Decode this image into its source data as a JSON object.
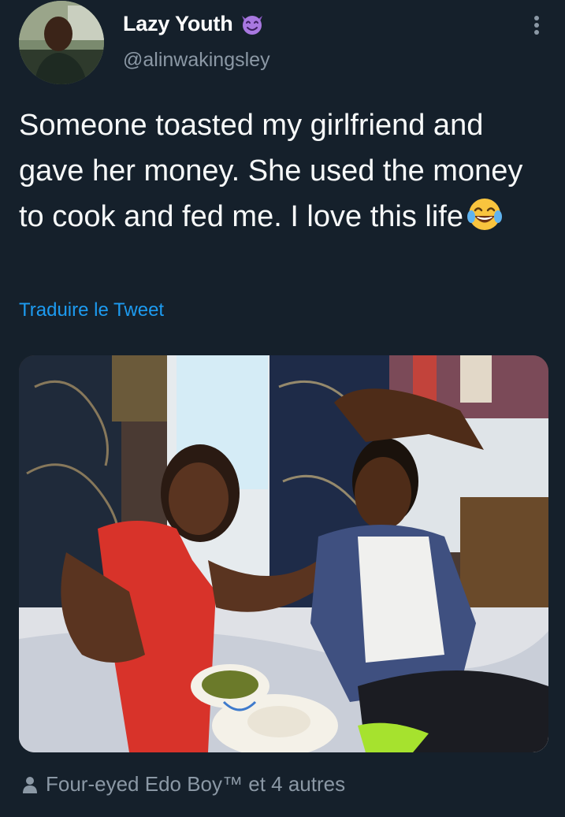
{
  "tweet": {
    "author": {
      "display_name": "Lazy Youth",
      "badge_emoji": "smiling-devil-emoji",
      "handle": "@alinwakingsley"
    },
    "text": "Someone toasted my girlfriend and gave her money. She used the money to cook and fed me. I love this life",
    "text_emoji": "face-with-tears-of-joy-emoji",
    "translate_label": "Traduire le Tweet",
    "tagged_people": "Four-eyed Edo Boy™ et 4 autres"
  },
  "colors": {
    "background": "#15202b",
    "primary_text": "#f7f9f9",
    "secondary_text": "#8b98a5",
    "link": "#1d9bf0"
  },
  "icons": {
    "more": "more-options-icon",
    "tag": "person-icon"
  }
}
